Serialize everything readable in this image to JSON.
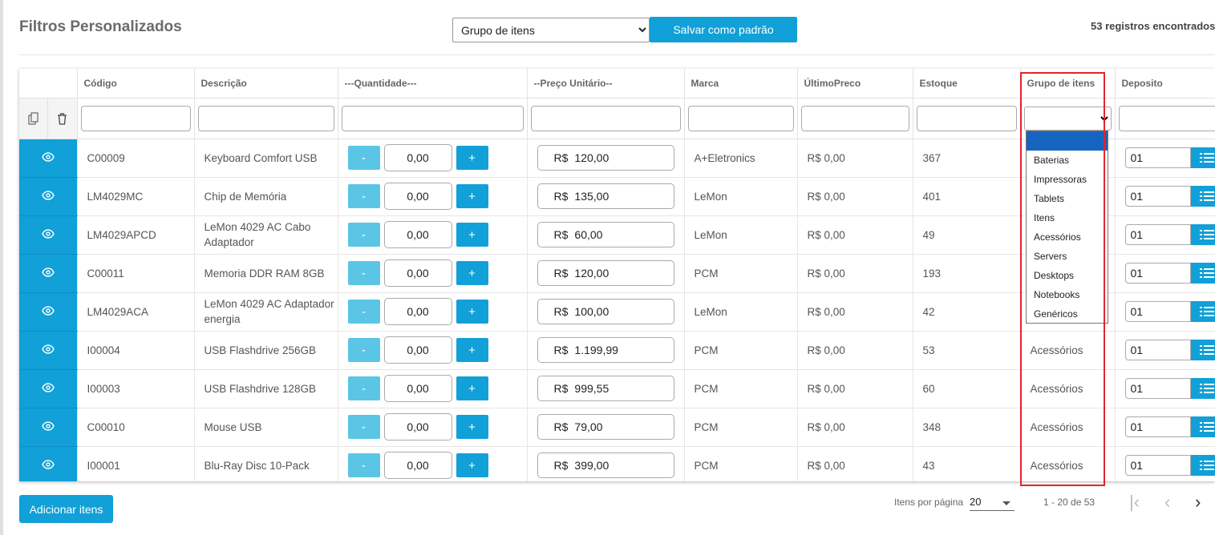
{
  "header": {
    "title": "Filtros Personalizados",
    "group_select_value": "Grupo de itens",
    "save_label": "Salvar como padrão",
    "records": "53 registros encontrados"
  },
  "columns": [
    "",
    "Código",
    "Descrição",
    "---Quantidade---",
    "--Preço Unitário--",
    "Marca",
    "ÚltimoPreco",
    "Estoque",
    "Grupo de itens",
    "Deposito"
  ],
  "rows": [
    {
      "code": "C00009",
      "desc": "Keyboard Comfort USB",
      "qty": "0,00",
      "currency": "R$",
      "price": "120,00",
      "brand": "A+Eletronics",
      "last": "R$ 0,00",
      "stock": "367",
      "group": "",
      "deposit": "01"
    },
    {
      "code": "LM4029MC",
      "desc": "Chip de Memória",
      "qty": "0,00",
      "currency": "R$",
      "price": "135,00",
      "brand": "LeMon",
      "last": "R$ 0,00",
      "stock": "401",
      "group": "",
      "deposit": "01"
    },
    {
      "code": "LM4029APCD",
      "desc": "LeMon 4029 AC Cabo Adaptador",
      "qty": "0,00",
      "currency": "R$",
      "price": "60,00",
      "brand": "LeMon",
      "last": "R$ 0,00",
      "stock": "49",
      "group": "",
      "deposit": "01"
    },
    {
      "code": "C00011",
      "desc": "Memoria DDR RAM 8GB",
      "qty": "0,00",
      "currency": "R$",
      "price": "120,00",
      "brand": "PCM",
      "last": "R$ 0,00",
      "stock": "193",
      "group": "",
      "deposit": "01"
    },
    {
      "code": "LM4029ACA",
      "desc": "LeMon 4029 AC Adaptador energia",
      "qty": "0,00",
      "currency": "R$",
      "price": "100,00",
      "brand": "LeMon",
      "last": "R$ 0,00",
      "stock": "42",
      "group": "",
      "deposit": "01"
    },
    {
      "code": "I00004",
      "desc": "USB Flashdrive 256GB",
      "qty": "0,00",
      "currency": "R$",
      "price": "1.199,99",
      "brand": "PCM",
      "last": "R$ 0,00",
      "stock": "53",
      "group": "Acessórios",
      "deposit": "01"
    },
    {
      "code": "I00003",
      "desc": "USB Flashdrive 128GB",
      "qty": "0,00",
      "currency": "R$",
      "price": "999,55",
      "brand": "PCM",
      "last": "R$ 0,00",
      "stock": "60",
      "group": "Acessórios",
      "deposit": "01"
    },
    {
      "code": "C00010",
      "desc": "Mouse USB",
      "qty": "0,00",
      "currency": "R$",
      "price": "79,00",
      "brand": "PCM",
      "last": "R$ 0,00",
      "stock": "348",
      "group": "Acessórios",
      "deposit": "01"
    },
    {
      "code": "I00001",
      "desc": "Blu-Ray Disc 10-Pack",
      "qty": "0,00",
      "currency": "R$",
      "price": "399,00",
      "brand": "PCM",
      "last": "R$ 0,00",
      "stock": "43",
      "group": "Acessórios",
      "deposit": "01"
    }
  ],
  "qty_minus": "-",
  "qty_plus": "+",
  "group_options": [
    "",
    "Baterias",
    "Impressoras",
    "Tablets",
    "Itens",
    "Acessórios",
    "Servers",
    "Desktops",
    "Notebooks",
    "Genéricos"
  ],
  "footer": {
    "add_label": "Adicionar itens",
    "per_page_label": "Itens por página",
    "per_page_value": "20",
    "range": "1 - 20 de 53",
    "first": "|‹",
    "prev": "‹",
    "next": "›"
  },
  "colors": {
    "accent": "#11a0d7",
    "accent_light": "#5bc5e6",
    "highlight": "#e3242b",
    "selected_option": "#1565c0"
  }
}
